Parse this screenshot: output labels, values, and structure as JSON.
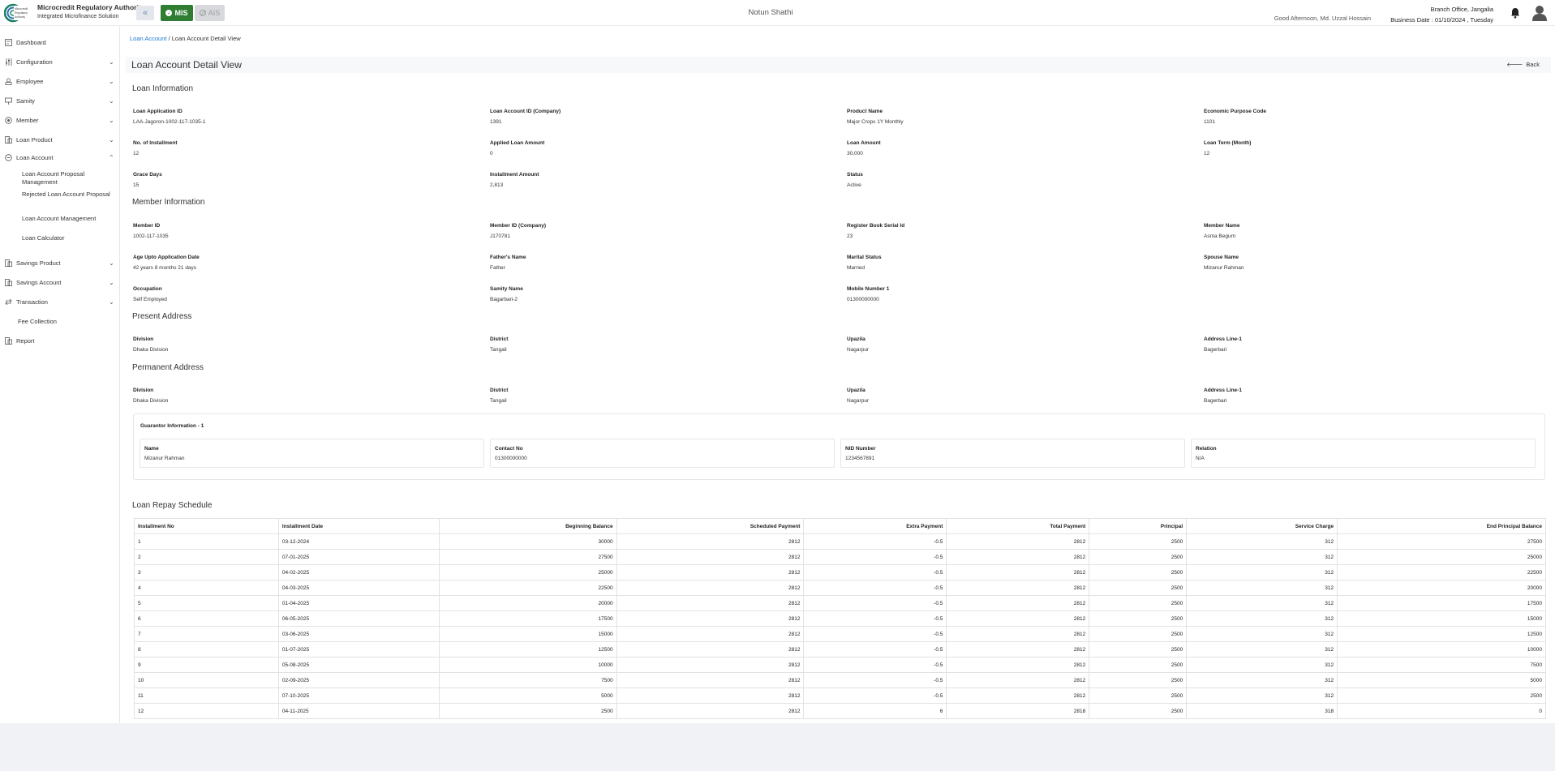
{
  "header": {
    "org_name": "Microcredit Regulatory Authority",
    "org_sub": "Integrated Microfinance Solution",
    "logo_text": "Microcredit Regulatory Authority",
    "mis_label": "MIS",
    "ais_label": "AIS",
    "app_title": "Notun Shathi",
    "greeting": "Good Afternoon, Md. Uzzal Hossain",
    "branch": "Branch Office, Jangalia",
    "business_date": "Business Date : 01/10/2024 , Tuesday"
  },
  "sidebar": {
    "items": [
      {
        "label": "Dashboard"
      },
      {
        "label": "Configuration"
      },
      {
        "label": "Employee"
      },
      {
        "label": "Samity"
      },
      {
        "label": "Member"
      },
      {
        "label": "Loan Product"
      },
      {
        "label": "Loan Account"
      },
      {
        "label": "Savings Product"
      },
      {
        "label": "Savings Account"
      },
      {
        "label": "Transaction"
      },
      {
        "label": "Fee Collection"
      },
      {
        "label": "Report"
      }
    ],
    "loan_account_sub": [
      {
        "label": "Loan Account Proposal Management"
      },
      {
        "label": "Rejected Loan Account Proposal"
      },
      {
        "label": "Loan Account Management"
      },
      {
        "label": "Loan Calculator"
      }
    ]
  },
  "breadcrumb": {
    "link": "Loan Account",
    "sep": "/",
    "current": "Loan Account Detail View"
  },
  "page": {
    "title": "Loan Account Detail View",
    "back": "Back"
  },
  "loan_info": {
    "title": "Loan Information",
    "fields": [
      {
        "k": "Loan Application ID",
        "v": "LAA-Jagoron-1002-117-1035-1"
      },
      {
        "k": "Loan Account ID (Company)",
        "v": "1391"
      },
      {
        "k": "Product Name",
        "v": "Major Crops 1Y Monthly"
      },
      {
        "k": "Economic Purpose Code",
        "v": "1101"
      },
      {
        "k": "No. of Installment",
        "v": "12"
      },
      {
        "k": "Applied Loan Amount",
        "v": "0"
      },
      {
        "k": "Loan Amount",
        "v": "30,000"
      },
      {
        "k": "Loan Term (Month)",
        "v": "12"
      },
      {
        "k": "Grace Days",
        "v": "15"
      },
      {
        "k": "Installment Amount",
        "v": "2,813"
      },
      {
        "k": "Status",
        "v": "Active"
      }
    ]
  },
  "member_info": {
    "title": "Member Information",
    "fields": [
      {
        "k": "Member ID",
        "v": "1002-117-1035"
      },
      {
        "k": "Member ID (Company)",
        "v": "J170781"
      },
      {
        "k": "Register Book Serial Id",
        "v": "23"
      },
      {
        "k": "Member Name",
        "v": "Asma Begum"
      },
      {
        "k": "Age Upto Application Date",
        "v": "42 years 8 months 21 days"
      },
      {
        "k": "Father's Name",
        "v": "Father"
      },
      {
        "k": "Marital Status",
        "v": "Married"
      },
      {
        "k": "Spouse Name",
        "v": "Mizanur Rahman"
      },
      {
        "k": "Occupation",
        "v": "Self Employed"
      },
      {
        "k": "Samity Name",
        "v": "Bagarbari-2"
      },
      {
        "k": "Mobile Number 1",
        "v": "01300000000"
      }
    ]
  },
  "present_address": {
    "title": "Present Address",
    "fields": [
      {
        "k": "Division",
        "v": "Dhaka Division"
      },
      {
        "k": "District",
        "v": "Tangail"
      },
      {
        "k": "Upazila",
        "v": "Nagarpur"
      },
      {
        "k": "Address Line-1",
        "v": "Bagerbari"
      }
    ]
  },
  "permanent_address": {
    "title": "Permanent Address",
    "fields": [
      {
        "k": "Division",
        "v": "Dhaka Division"
      },
      {
        "k": "District",
        "v": "Tangail"
      },
      {
        "k": "Upazila",
        "v": "Nagarpur"
      },
      {
        "k": "Address Line-1",
        "v": "Bagerbari"
      }
    ]
  },
  "guarantor": {
    "title": "Guarantor Information - 1",
    "fields": [
      {
        "k": "Name",
        "v": "Mizanur Rahman"
      },
      {
        "k": "Contact No",
        "v": "01300000000"
      },
      {
        "k": "NID Number",
        "v": "1234567891"
      },
      {
        "k": "Relation",
        "v": "N/A"
      }
    ]
  },
  "schedule": {
    "title": "Loan Repay Schedule",
    "headers": [
      "Installment No",
      "Installment Date",
      "Beginning Balance",
      "Scheduled Payment",
      "Extra Payment",
      "Total Payment",
      "Principal",
      "Service Charge",
      "End Principal Balance"
    ],
    "rows": [
      [
        "1",
        "03-12-2024",
        "30000",
        "2812",
        "-0.5",
        "2812",
        "2500",
        "312",
        "27500"
      ],
      [
        "2",
        "07-01-2025",
        "27500",
        "2812",
        "-0.5",
        "2812",
        "2500",
        "312",
        "25000"
      ],
      [
        "3",
        "04-02-2025",
        "25000",
        "2812",
        "-0.5",
        "2812",
        "2500",
        "312",
        "22500"
      ],
      [
        "4",
        "04-03-2025",
        "22500",
        "2812",
        "-0.5",
        "2812",
        "2500",
        "312",
        "20000"
      ],
      [
        "5",
        "01-04-2025",
        "20000",
        "2812",
        "-0.5",
        "2812",
        "2500",
        "312",
        "17500"
      ],
      [
        "6",
        "06-05-2025",
        "17500",
        "2812",
        "-0.5",
        "2812",
        "2500",
        "312",
        "15000"
      ],
      [
        "7",
        "03-06-2025",
        "15000",
        "2812",
        "-0.5",
        "2812",
        "2500",
        "312",
        "12500"
      ],
      [
        "8",
        "01-07-2025",
        "12500",
        "2812",
        "-0.5",
        "2812",
        "2500",
        "312",
        "10000"
      ],
      [
        "9",
        "05-08-2025",
        "10000",
        "2812",
        "-0.5",
        "2812",
        "2500",
        "312",
        "7500"
      ],
      [
        "10",
        "02-09-2025",
        "7500",
        "2812",
        "-0.5",
        "2812",
        "2500",
        "312",
        "5000"
      ],
      [
        "11",
        "07-10-2025",
        "5000",
        "2812",
        "-0.5",
        "2812",
        "2500",
        "312",
        "2500"
      ],
      [
        "12",
        "04-11-2025",
        "2500",
        "2812",
        "6",
        "2818",
        "2500",
        "318",
        "0"
      ]
    ]
  },
  "colors": {
    "accent": "#1976d2",
    "mis": "#2e7d32",
    "ais": "#d7d9dc"
  }
}
